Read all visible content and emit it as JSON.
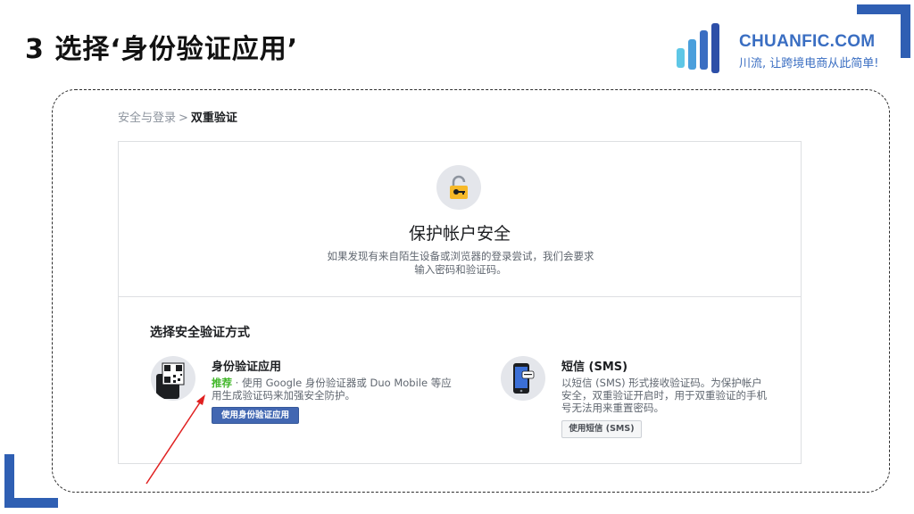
{
  "slide": {
    "title": "3 选择‘身份验证应用’"
  },
  "brand": {
    "name": "CHUANFIC.COM",
    "slogan": "川流, 让跨境电商从此简单!",
    "colors": [
      "#3a6ec2",
      "#5ec7e6"
    ]
  },
  "breadcrumb": {
    "parent": "安全与登录",
    "separator": ">",
    "current": "双重验证"
  },
  "hero": {
    "icon": "lock-key-icon",
    "title": "保护帐户安全",
    "description": "如果发现有来自陌生设备或浏览器的登录尝试，我们会要求输入密码和验证码。"
  },
  "methods": {
    "heading": "选择安全验证方式",
    "auth_app": {
      "icon": "qr-phone-icon",
      "name": "身份验证应用",
      "recommend_label": "推荐",
      "description": " · 使用 Google 身份验证器或 Duo Mobile 等应用生成验证码来加强安全防护。",
      "button": "使用身份验证应用"
    },
    "sms": {
      "icon": "phone-message-icon",
      "name": "短信 (SMS)",
      "description": "以短信 (SMS) 形式接收验证码。为保护帐户安全，双重验证开启时，用于双重验证的手机号无法用来重置密码。",
      "button": "使用短信 (SMS)"
    }
  },
  "colors": {
    "accent": "#2f5fb3",
    "facebook_blue": "#4267b2",
    "recommend_green": "#42b72a",
    "annotation_arrow": "#e02020"
  }
}
